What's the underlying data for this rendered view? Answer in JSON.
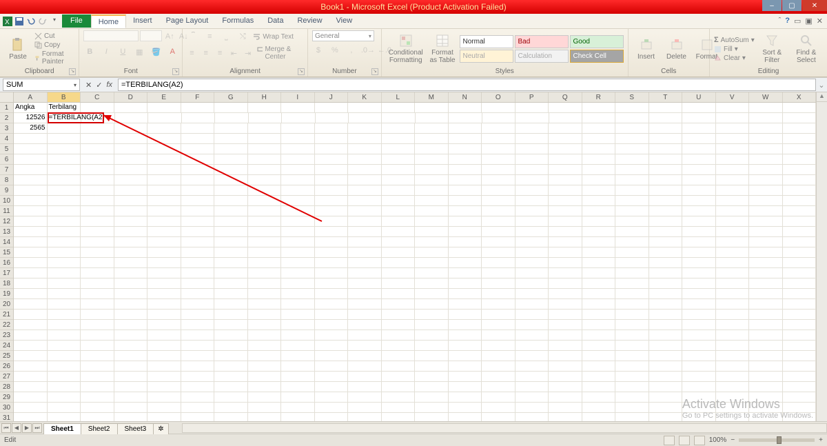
{
  "titlebar": {
    "title": "Book1 - Microsoft Excel (Product Activation Failed)"
  },
  "tabs": {
    "file": "File",
    "home": "Home",
    "insert": "Insert",
    "page_layout": "Page Layout",
    "formulas": "Formulas",
    "data": "Data",
    "review": "Review",
    "view": "View"
  },
  "ribbon": {
    "clipboard": {
      "label": "Clipboard",
      "paste": "Paste",
      "cut": "Cut",
      "copy": "Copy",
      "format_painter": "Format Painter"
    },
    "font": {
      "label": "Font"
    },
    "alignment": {
      "label": "Alignment",
      "wrap": "Wrap Text",
      "merge": "Merge & Center"
    },
    "number": {
      "label": "Number",
      "format": "General"
    },
    "styles": {
      "label": "Styles",
      "conditional": "Conditional Formatting",
      "table": "Format as Table",
      "normal": "Normal",
      "bad": "Bad",
      "good": "Good",
      "neutral": "Neutral",
      "calculation": "Calculation",
      "check": "Check Cell"
    },
    "cells": {
      "label": "Cells",
      "insert": "Insert",
      "delete": "Delete",
      "format": "Format"
    },
    "editing": {
      "label": "Editing",
      "autosum": "AutoSum",
      "fill": "Fill",
      "clear": "Clear",
      "sort": "Sort & Filter",
      "find": "Find & Select"
    }
  },
  "formulabar": {
    "name": "SUM",
    "formula": "=TERBILANG(A2)"
  },
  "columns": [
    "A",
    "B",
    "C",
    "D",
    "E",
    "F",
    "G",
    "H",
    "I",
    "J",
    "K",
    "L",
    "M",
    "N",
    "O",
    "P",
    "Q",
    "R",
    "S",
    "T",
    "U",
    "V",
    "W",
    "X"
  ],
  "rows": 31,
  "data": {
    "A1": "Angka",
    "B1": "Terbilang",
    "A2": "12526",
    "B2": "=TERBILANG(A2)",
    "A3": "2565"
  },
  "active_cell": "B2",
  "sheets": {
    "s1": "Sheet1",
    "s2": "Sheet2",
    "s3": "Sheet3"
  },
  "status": {
    "mode": "Edit",
    "zoom": "100%"
  },
  "watermark": {
    "title": "Activate Windows",
    "sub": "Go to PC settings to activate Windows."
  }
}
